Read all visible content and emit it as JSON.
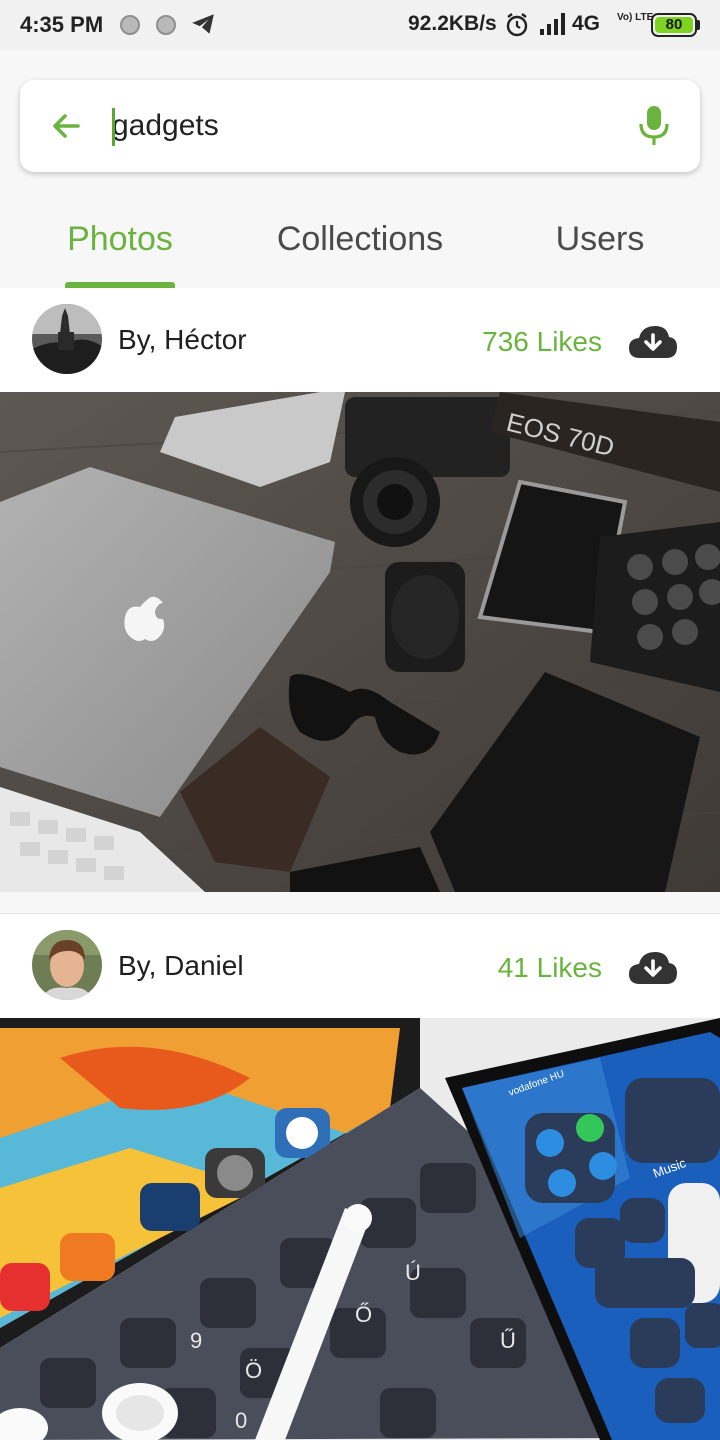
{
  "status_bar": {
    "time": "4:35 PM",
    "speed": "92.2KB/s",
    "network": "4G",
    "network_sub": "Vo) LTE",
    "battery": "80"
  },
  "search": {
    "query": "gadgets",
    "back_icon": "arrow-left-icon",
    "mic_icon": "mic-icon"
  },
  "tabs": [
    {
      "label": "Photos",
      "active": true
    },
    {
      "label": "Collections",
      "active": false
    },
    {
      "label": "Users",
      "active": false
    }
  ],
  "posts": [
    {
      "author": "By, Héctor",
      "likes": "736 Likes",
      "avatar_icon": "avatar",
      "download_icon": "cloud-download-icon",
      "photo": "gadgets-flatlay-laptop-camera"
    },
    {
      "author": "By, Daniel",
      "likes": "41 Likes",
      "avatar_icon": "avatar",
      "download_icon": "cloud-download-icon",
      "photo": "ipad-keyboard-iphone"
    }
  ],
  "colors": {
    "accent": "#6ab33f",
    "text": "#1f1f1f",
    "tab_inactive": "#4a4a4a",
    "header_bg": "#f7f7f7"
  }
}
